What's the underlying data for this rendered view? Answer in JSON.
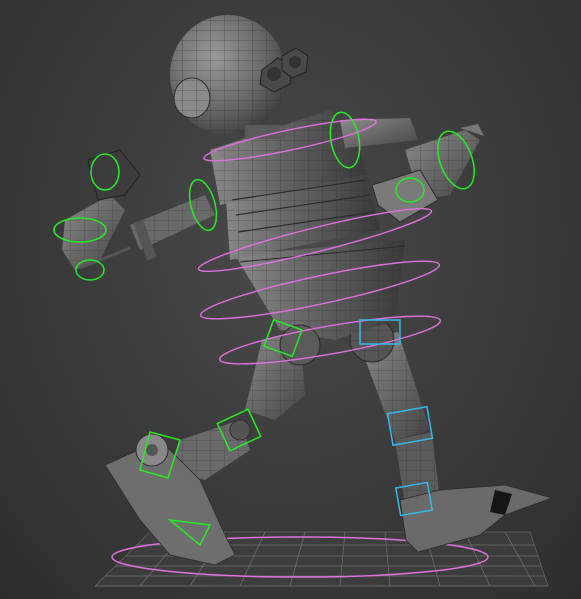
{
  "viewport": {
    "background": "#3d3d3d",
    "grid_color": "#8a8a8a",
    "mesh_color": "#6e6e6e",
    "wire_color": "#2b2b2b",
    "control_colors": {
      "fk_rings": "#22ee22",
      "spine_rings": "#e070e0",
      "leg_boxes": "#33bbee"
    }
  },
  "model": {
    "character": "robot",
    "icons": [
      "robot-head-icon",
      "control-ring-icon",
      "ik-box-icon",
      "ground-grid-icon"
    ]
  }
}
